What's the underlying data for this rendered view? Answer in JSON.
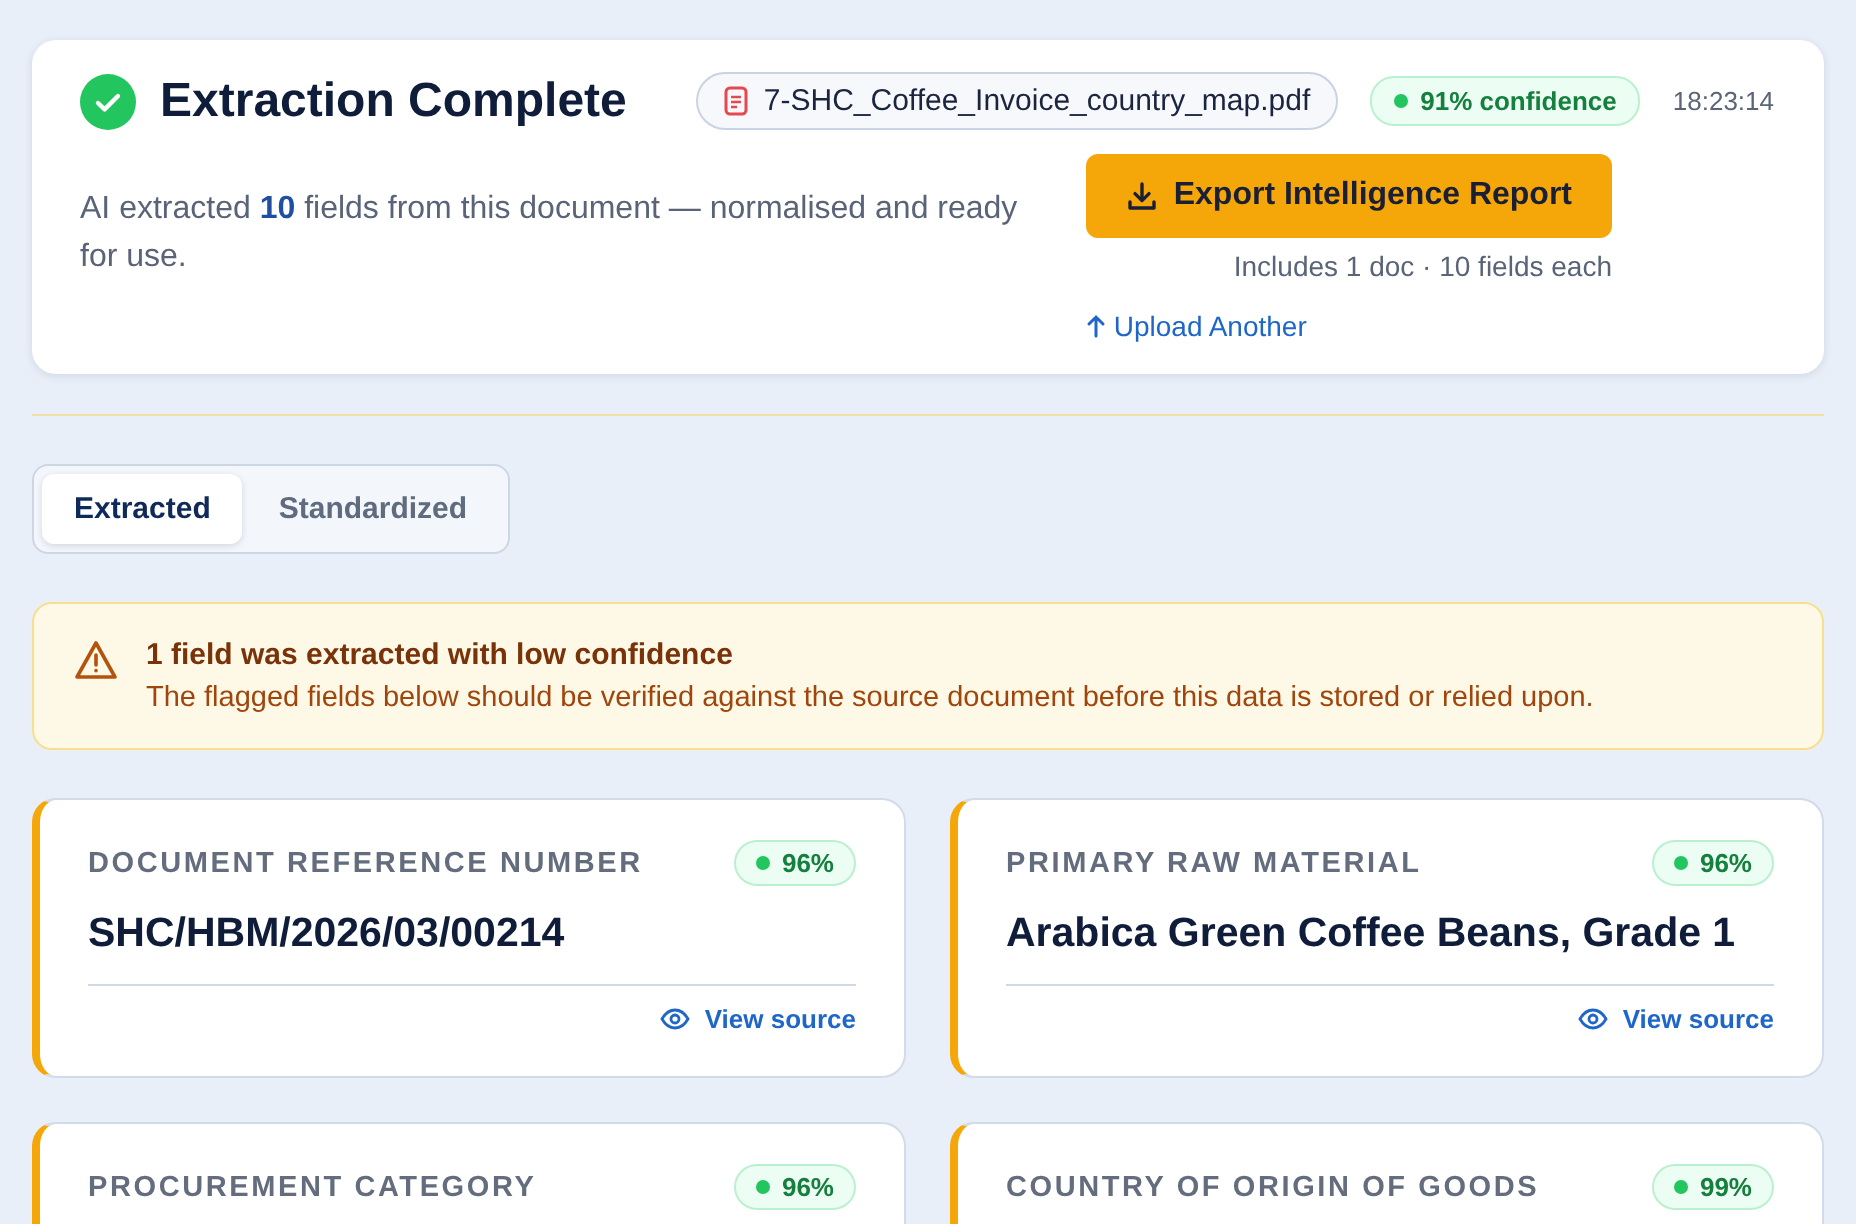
{
  "header": {
    "title": "Extraction Complete",
    "file_name": "7-SHC_Coffee_Invoice_country_map.pdf",
    "confidence": "91% confidence",
    "time": "18:23:14",
    "summary": "AI extracted **10** fields from this document — normalised and ready for use.",
    "export_button": "Export Intelligence Report",
    "export_note": "Includes 1 doc · 10 fields each",
    "upload_link": "Upload Another"
  },
  "tabs": [
    {
      "label": "Extracted",
      "selected": true
    },
    {
      "label": "Standardized",
      "selected": false
    }
  ],
  "alert": {
    "title": "1 field was extracted with low confidence",
    "message": "The flagged fields below should be verified against the source document before this data is stored or relied upon."
  },
  "fields": [
    {
      "label": "DOCUMENT REFERENCE NUMBER",
      "confidence": "96%",
      "value": "SHC/HBM/2026/03/00214",
      "link": "View source"
    },
    {
      "label": "PRIMARY RAW MATERIAL",
      "confidence": "96%",
      "value": "Arabica Green Coffee Beans, Grade 1",
      "link": "View source"
    },
    {
      "label": "PROCUREMENT CATEGORY",
      "confidence": "96%"
    },
    {
      "label": "COUNTRY OF ORIGIN OF GOODS",
      "confidence": "99%"
    }
  ]
}
